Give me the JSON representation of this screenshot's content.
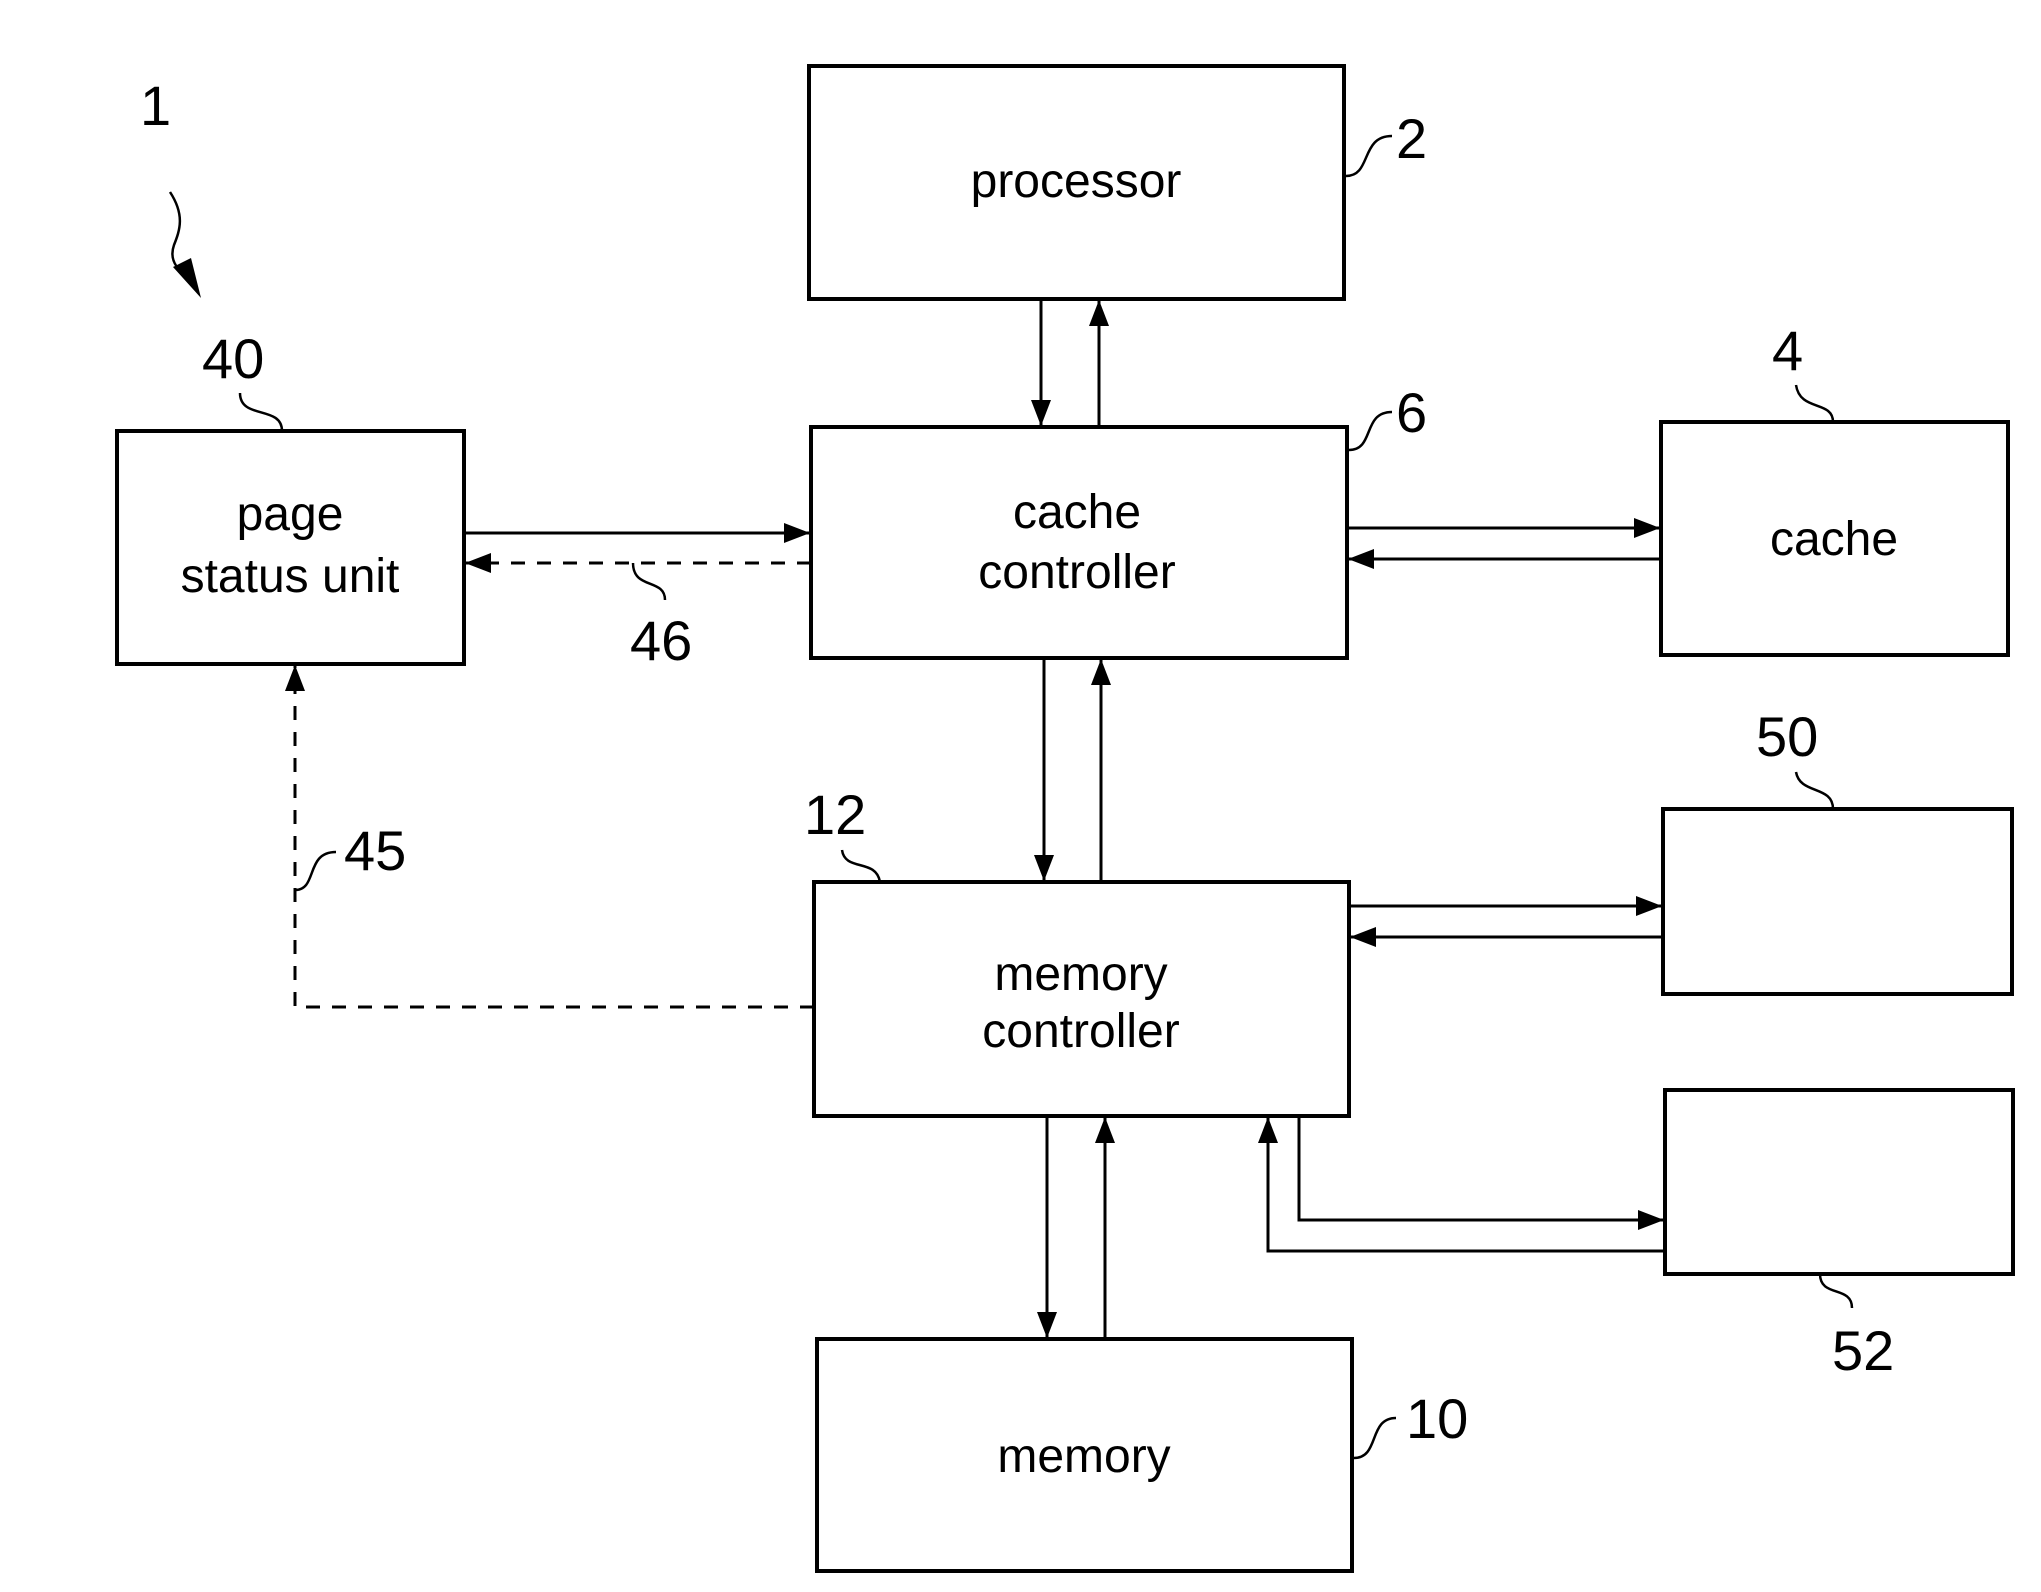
{
  "figure": {
    "ref": "1",
    "blocks": {
      "processor": {
        "label": [
          "processor"
        ],
        "ref": "2"
      },
      "cache_controller": {
        "label": [
          "cache",
          "controller"
        ],
        "ref": "6"
      },
      "cache": {
        "label": [
          "cache"
        ],
        "ref": "4"
      },
      "page_status_unit": {
        "label": [
          "page",
          "status unit"
        ],
        "ref": "40"
      },
      "memory_controller": {
        "label": [
          "memory",
          "controller"
        ],
        "ref": "12"
      },
      "block_50": {
        "label": [],
        "ref": "50"
      },
      "block_52": {
        "label": [],
        "ref": "52"
      },
      "memory": {
        "label": [
          "memory"
        ],
        "ref": "10"
      }
    },
    "signals": {
      "page_status_feedback": {
        "ref": "46",
        "style": "dashed"
      },
      "memory_controller_status": {
        "ref": "45",
        "style": "dashed"
      }
    },
    "connections": [
      {
        "from": "processor",
        "to": "cache_controller"
      },
      {
        "from": "cache_controller",
        "to": "processor"
      },
      {
        "from": "page_status_unit",
        "to": "cache_controller"
      },
      {
        "from": "cache_controller",
        "to": "page_status_unit",
        "signal": "46"
      },
      {
        "from": "cache_controller",
        "to": "cache"
      },
      {
        "from": "cache",
        "to": "cache_controller"
      },
      {
        "from": "cache_controller",
        "to": "memory_controller"
      },
      {
        "from": "memory_controller",
        "to": "cache_controller"
      },
      {
        "from": "memory_controller",
        "to": "page_status_unit",
        "signal": "45"
      },
      {
        "from": "memory_controller",
        "to": "block_50"
      },
      {
        "from": "block_50",
        "to": "memory_controller"
      },
      {
        "from": "memory_controller",
        "to": "block_52"
      },
      {
        "from": "block_52",
        "to": "memory_controller"
      },
      {
        "from": "memory_controller",
        "to": "memory"
      },
      {
        "from": "memory",
        "to": "memory_controller"
      }
    ]
  }
}
